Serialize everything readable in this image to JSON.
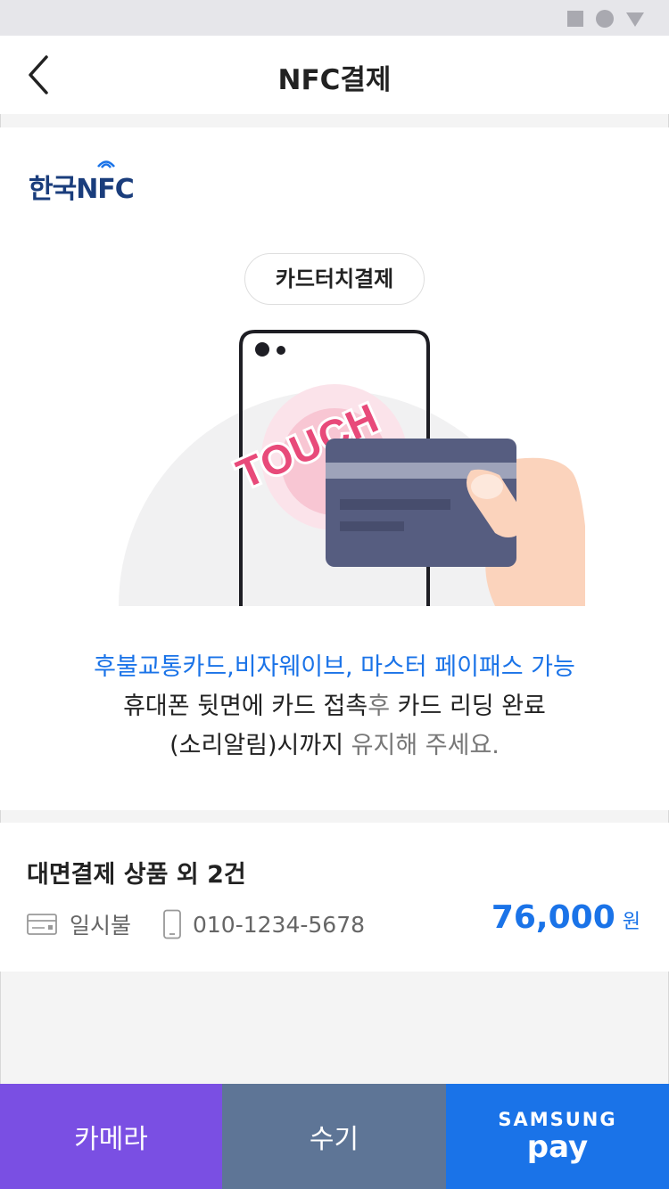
{
  "header": {
    "title": "NFC결제",
    "back_icon": "chevron-left-icon"
  },
  "brand": {
    "name": "한국NFC",
    "korean": "한국",
    "latin": "NFC"
  },
  "touch_pill": {
    "label": "카드터치결제"
  },
  "illustration": {
    "touch_text": "TOUCH"
  },
  "instructions": {
    "line1": "후불교통카드,비자웨이브, 마스터 페이패스 가능",
    "line2a": "휴대폰 뒷면에 카드 접촉",
    "line2b": "후",
    "line2c": " 카드 리딩 완료",
    "line3a": "(소리알림)시까지",
    "line3b": " 유지해 주세요."
  },
  "order": {
    "title": "대면결제 상품 외 2건",
    "payment_type": "일시불",
    "phone": "010-1234-5678",
    "amount": "76,000",
    "currency_unit": "원"
  },
  "buttons": {
    "camera": "카메라",
    "manual": "수기",
    "samsung_top": "SAMSUNG",
    "samsung_bottom": "pay"
  },
  "colors": {
    "primary_blue": "#1a73e8",
    "camera_purple": "#7a4fe3",
    "manual_slate": "#5e7596",
    "touch_pink": "#e84a7a",
    "card_navy": "#565d80"
  }
}
